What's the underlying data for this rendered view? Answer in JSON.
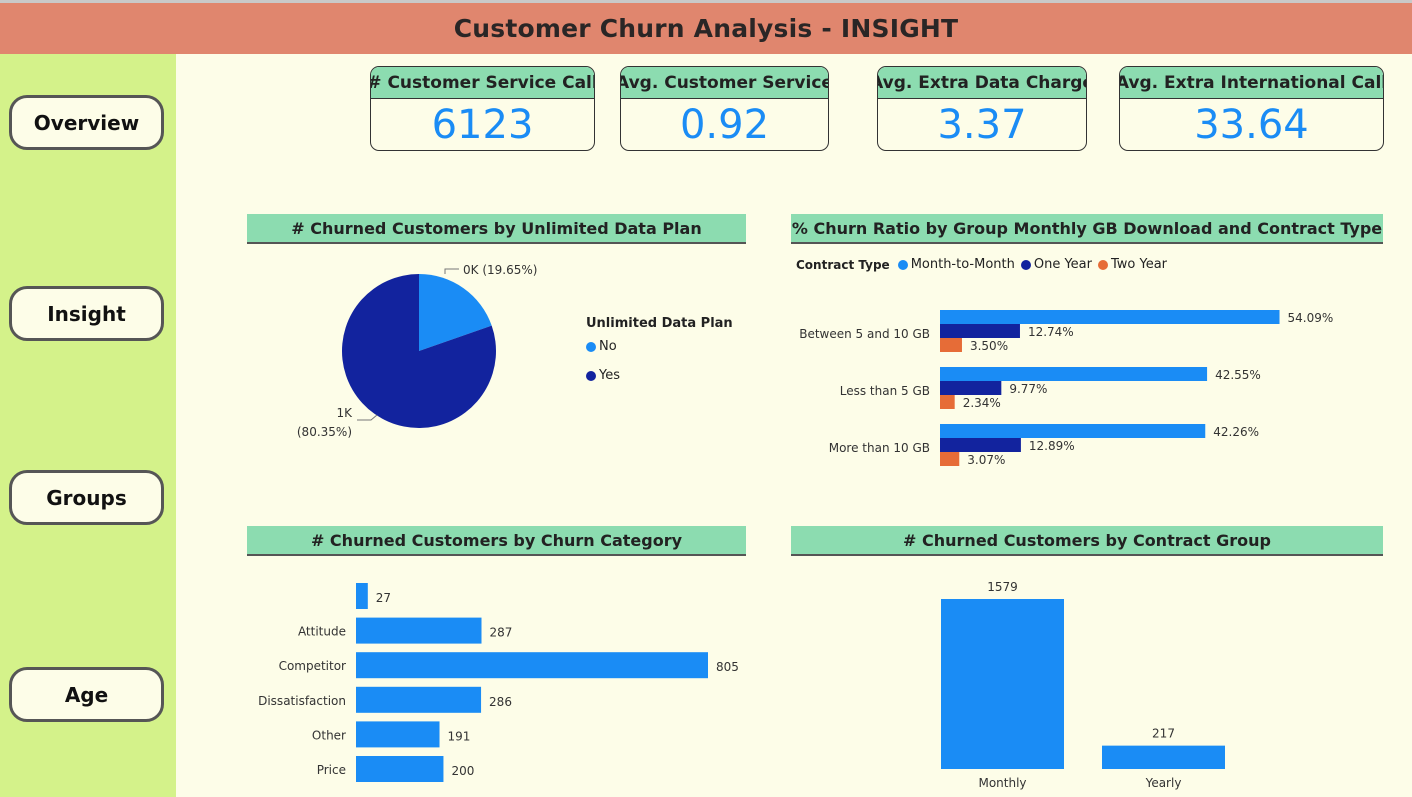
{
  "header": {
    "title": "Customer Churn Analysis - INSIGHT"
  },
  "nav": {
    "items": [
      "Overview",
      "Insight",
      "Groups",
      "Age"
    ]
  },
  "kpis": [
    {
      "label": "# Customer Service Call",
      "value": "6123"
    },
    {
      "label": "Avg. Customer Service",
      "value": "0.92"
    },
    {
      "label": "Avg. Extra Data Charge",
      "value": "3.37"
    },
    {
      "label": "Avg. Extra International Call",
      "value": "33.64"
    }
  ],
  "colors": {
    "month_to_month": "#1a8cf5",
    "one_year": "#12239e",
    "two_year": "#e66c37"
  },
  "chart_data": [
    {
      "id": "pie",
      "type": "pie",
      "title": "# Churned Customers by Unlimited Data Plan",
      "legend_title": "Unlimited Data Plan",
      "slices": [
        {
          "name": "No",
          "percent": 19.65,
          "label": "0K (19.65%)",
          "color": "#1a8cf5"
        },
        {
          "name": "Yes",
          "percent": 80.35,
          "label_value": "1K",
          "label_pct": "(80.35%)",
          "color": "#12239e"
        }
      ]
    },
    {
      "id": "churn_ratio",
      "type": "bar",
      "orientation": "horizontal",
      "title": "% Churn Ratio by Group Monthly GB Download and Contract Type",
      "legend_title": "Contract Type",
      "categories": [
        "Between 5 and 10 GB",
        "Less than 5 GB",
        "More than 10 GB"
      ],
      "series": [
        {
          "name": "Month-to-Month",
          "color": "#1a8cf5",
          "values": [
            54.09,
            42.55,
            42.26
          ],
          "labels": [
            "54.09%",
            "42.55%",
            "42.26%"
          ]
        },
        {
          "name": "One Year",
          "color": "#12239e",
          "values": [
            12.74,
            9.77,
            12.89
          ],
          "labels": [
            "12.74%",
            "9.77%",
            "12.89%"
          ]
        },
        {
          "name": "Two Year",
          "color": "#e66c37",
          "values": [
            3.5,
            2.34,
            3.07
          ],
          "labels": [
            "3.50%",
            "2.34%",
            "3.07%"
          ]
        }
      ],
      "xlim": [
        0,
        60
      ]
    },
    {
      "id": "churn_category",
      "type": "bar",
      "orientation": "horizontal",
      "title": "# Churned Customers by Churn Category",
      "categories": [
        "",
        "Attitude",
        "Competitor",
        "Dissatisfaction",
        "Other",
        "Price"
      ],
      "values": [
        27,
        287,
        805,
        286,
        191,
        200
      ],
      "labels": [
        "27",
        "287",
        "805",
        "286",
        "191",
        "200"
      ],
      "color": "#1a8cf5",
      "xlim": [
        0,
        805
      ]
    },
    {
      "id": "contract_group",
      "type": "bar",
      "orientation": "vertical",
      "title": "# Churned Customers by Contract Group",
      "categories": [
        "Monthly",
        "Yearly"
      ],
      "values": [
        1579,
        217
      ],
      "labels": [
        "1579",
        "217"
      ],
      "color": "#1a8cf5",
      "ylim": [
        0,
        1579
      ]
    }
  ]
}
